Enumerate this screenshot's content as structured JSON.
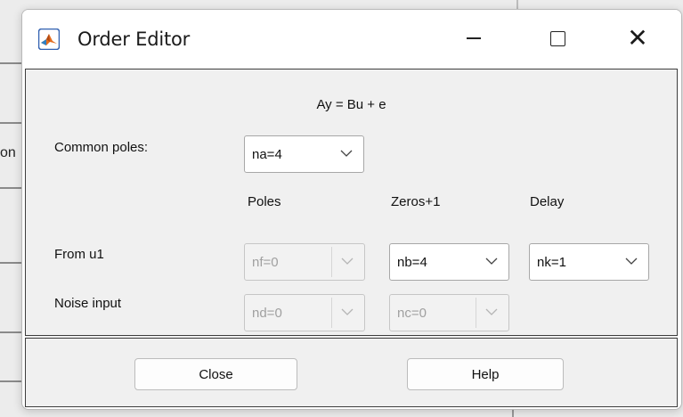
{
  "background": {
    "partial_text": "on"
  },
  "window": {
    "title": "Order Editor",
    "controls": {
      "minimize": "minimize",
      "maximize": "maximize",
      "close": "close"
    }
  },
  "equation": "Ay = Bu + e",
  "common_poles": {
    "label": "Common poles:",
    "value": "na=4"
  },
  "columns": {
    "poles": "Poles",
    "zeros": "Zeros+1",
    "delay": "Delay"
  },
  "rows": {
    "from_u1": {
      "label": "From u1",
      "poles": "nf=0",
      "zeros": "nb=4",
      "delay": "nk=1"
    },
    "noise_input": {
      "label": "Noise input",
      "poles": "nd=0",
      "zeros": "nc=0"
    }
  },
  "buttons": {
    "close": "Close",
    "help": "Help"
  },
  "colors": {
    "accent_icon_blue": "#2f5fb0",
    "accent_icon_orange": "#e36d1f",
    "panel_border": "#3d3d3d",
    "dialog_bg": "#f0f0f0"
  }
}
